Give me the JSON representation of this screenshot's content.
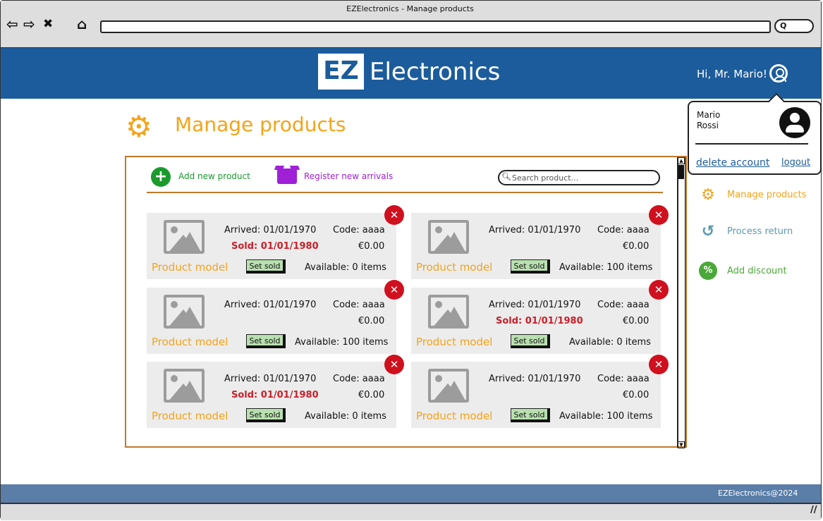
{
  "window": {
    "title": "EZElectronics - Manage products"
  },
  "nav": {
    "back": "⇦",
    "forward": "⇨",
    "close": "✖",
    "home": "⌂",
    "pill": "Q"
  },
  "header": {
    "logo_ez": "EZ",
    "logo_text": "Electronics",
    "greeting": "Hi, Mr. Mario!"
  },
  "page": {
    "title": "Manage products"
  },
  "toolbar": {
    "add_label": "Add new product",
    "register_label": "Register new arrivals",
    "search_placeholder": "Search product..."
  },
  "products": [
    {
      "arrived": "Arrived: 01/01/1970",
      "code": "Code: aaaa",
      "sold": "Sold: 01/01/1980",
      "price": "€0.00",
      "model": "Product model",
      "set_sold": "Set sold",
      "available": "Available: 0 items"
    },
    {
      "arrived": "Arrived: 01/01/1970",
      "code": "Code: aaaa",
      "sold": "",
      "price": "€0.00",
      "model": "Product model",
      "set_sold": "Set sold",
      "available": "Available: 100 items"
    },
    {
      "arrived": "Arrived: 01/01/1970",
      "code": "Code: aaaa",
      "sold": "",
      "price": "€0.00",
      "model": "Product model",
      "set_sold": "Set sold",
      "available": "Available: 100 items"
    },
    {
      "arrived": "Arrived: 01/01/1970",
      "code": "Code: aaaa",
      "sold": "Sold: 01/01/1980",
      "price": "€0.00",
      "model": "Product model",
      "set_sold": "Set sold",
      "available": "Available: 0 items"
    },
    {
      "arrived": "Arrived: 01/01/1970",
      "code": "Code: aaaa",
      "sold": "Sold: 01/01/1980",
      "price": "€0.00",
      "model": "Product model",
      "set_sold": "Set sold",
      "available": "Available: 0 items"
    },
    {
      "arrived": "Arrived: 01/01/1970",
      "code": "Code: aaaa",
      "sold": "",
      "price": "€0.00",
      "model": "Product model",
      "set_sold": "Set sold",
      "available": "Available: 100 items"
    }
  ],
  "user_menu": {
    "first_name": "Mario",
    "last_name": "Rossi",
    "delete_account": "delete account",
    "logout": "logout"
  },
  "side_menu": [
    {
      "label": "Manage products",
      "icon": "gear-icon",
      "color": "#f5a31a"
    },
    {
      "label": "Process return",
      "icon": "return-arrow-icon",
      "color": "#5a9ab0"
    },
    {
      "label": "Add discount",
      "icon": "discount-badge-icon",
      "color": "#4aa838"
    }
  ],
  "footer": {
    "text": "EZElectronics@2024"
  },
  "colors": {
    "header": "#1c5c9c",
    "accent": "#f5a31a",
    "add": "#1a9a2c",
    "register": "#a020d8",
    "delete": "#d0101e",
    "footer": "#5a7ea8"
  }
}
